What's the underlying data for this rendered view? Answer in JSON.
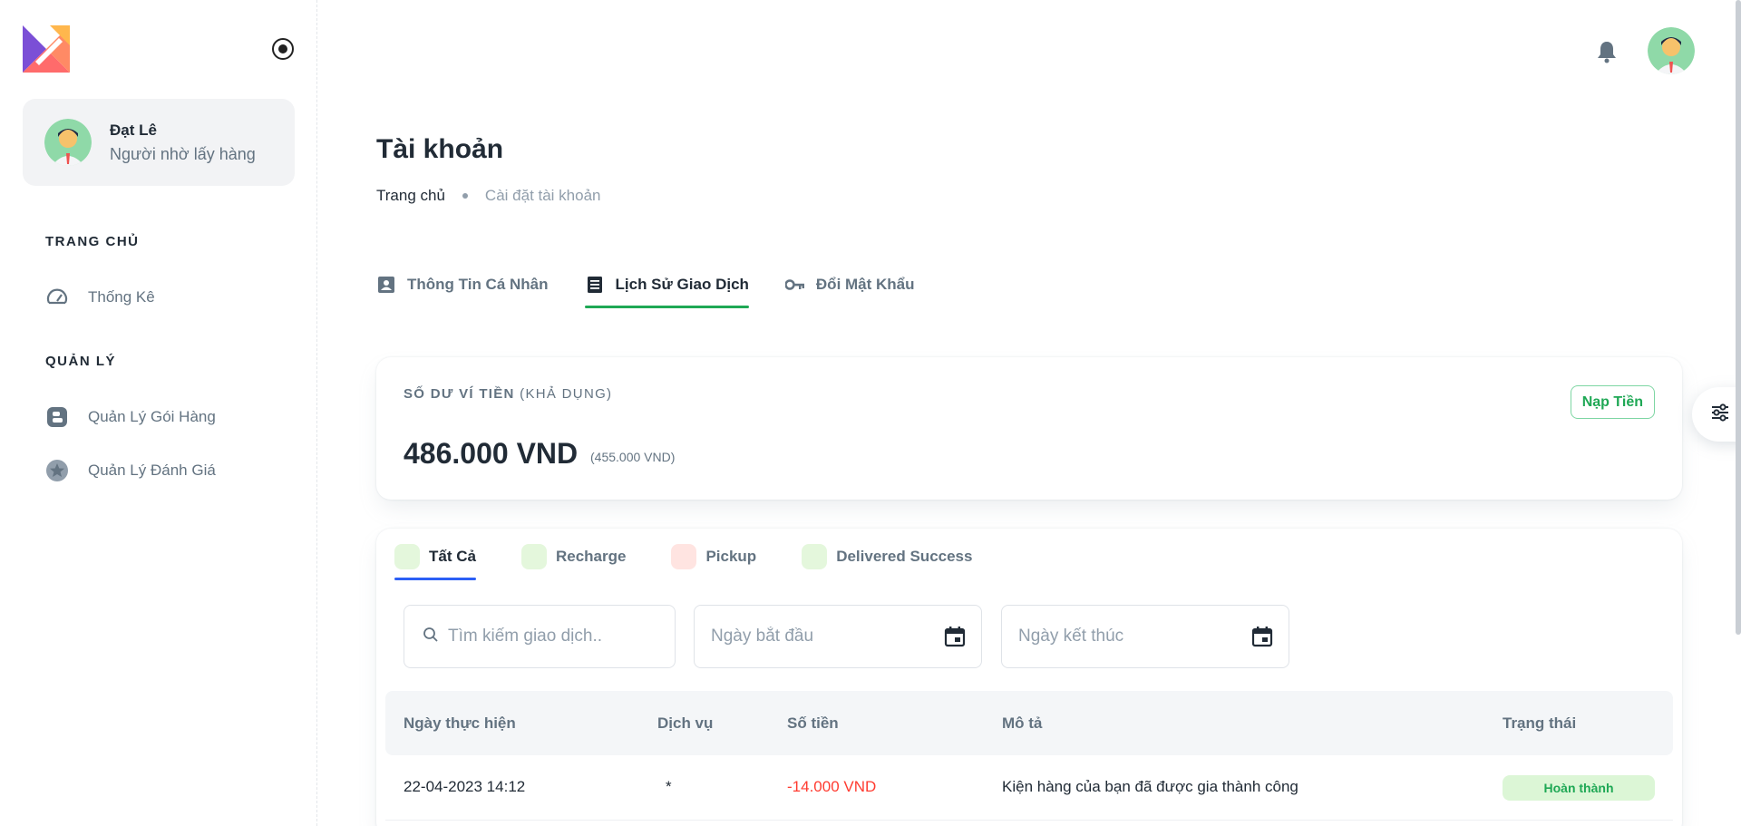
{
  "sidebar": {
    "user": {
      "name": "Đạt Lê",
      "role": "Người nhờ lấy hàng"
    },
    "sections": [
      {
        "title": "TRANG CHỦ",
        "items": [
          {
            "label": "Thống Kê",
            "icon": "dashboard-icon"
          }
        ]
      },
      {
        "title": "QUẢN LÝ",
        "items": [
          {
            "label": "Quản Lý Gói Hàng",
            "icon": "package-icon"
          },
          {
            "label": "Quản Lý Đánh Giá",
            "icon": "star-icon"
          }
        ]
      }
    ]
  },
  "header": {
    "title": "Tài khoản",
    "breadcrumb": {
      "home": "Trang chủ",
      "current": "Cài đặt tài khoản"
    }
  },
  "tabs": [
    {
      "label": "Thông Tin Cá Nhân",
      "icon": "id-card-icon",
      "active": false
    },
    {
      "label": "Lịch Sử Giao Dịch",
      "icon": "receipt-icon",
      "active": true
    },
    {
      "label": "Đổi Mật Khẩu",
      "icon": "key-icon",
      "active": false
    }
  ],
  "wallet": {
    "label": "SỐ DƯ VÍ TIỀN",
    "label_sub": "(KHẢ DỤNG)",
    "balance": "486.000 VND",
    "available": "(455.000 VND)",
    "topup_label": "Nạp Tiền"
  },
  "filters": {
    "tabs": [
      {
        "label": "Tất Cả",
        "color": "#e4f7dc",
        "active": true
      },
      {
        "label": "Recharge",
        "color": "#e4f7dc",
        "active": false
      },
      {
        "label": "Pickup",
        "color": "#ffe4e1",
        "active": false
      },
      {
        "label": "Delivered Success",
        "color": "#e4f7dc",
        "active": false
      }
    ],
    "search_placeholder": "Tìm kiếm giao dịch..",
    "start_placeholder": "Ngày bắt đầu",
    "end_placeholder": "Ngày kết thúc"
  },
  "table": {
    "columns": [
      "Ngày thực hiện",
      "Dịch vụ",
      "Số tiền",
      "Mô tả",
      "Trạng thái"
    ],
    "rows": [
      {
        "date": "22-04-2023 14:12",
        "service": "*",
        "amount": "-14.000 VND",
        "description": "Kiện hàng của bạn đã được gia thành công",
        "status": "Hoàn thành"
      }
    ]
  },
  "colors": {
    "accent_green": "#1fa855",
    "tab_underline_blue": "#2c5ff6",
    "negative_amount": "#ff3b30"
  }
}
